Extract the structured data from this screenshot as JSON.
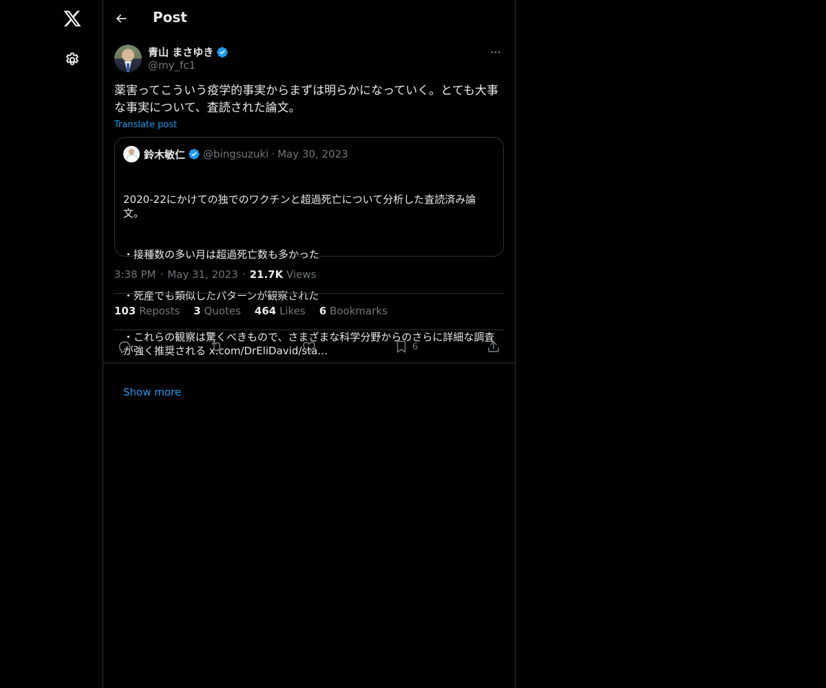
{
  "header": {
    "title": "Post"
  },
  "post": {
    "author": {
      "name": "青山 まさゆき",
      "handle": "@my_fc1"
    },
    "text": "薬害ってこういう疫学的事実からまずは明らかになっていく。とても大事な事実について、査読された論文。",
    "translate_label": "Translate post",
    "quote": {
      "author": {
        "name": "鈴木敏仁",
        "handle": "@bingsuzuki"
      },
      "separator": "·",
      "date": "May 30, 2023",
      "lines": [
        "2020-22にかけての独でのワクチンと超過死亡について分析した査読済み論文。",
        "・接種数の多い月は超過死亡数も多かった",
        "・死産でも類似したパターンが観察された",
        "・これらの観察は驚くべきもので、さまざまな科学分野からのさらに詳細な調査が強く推奨される x.com/DrEliDavid/sta…"
      ],
      "show_more": "Show more"
    },
    "meta": {
      "time": "3:38 PM",
      "dot": "·",
      "date": "May 31, 2023",
      "views_count": "21.7K",
      "views_label": "Views"
    },
    "stats": {
      "reposts_count": "103",
      "reposts_label": "Reposts",
      "quotes_count": "3",
      "quotes_label": "Quotes",
      "likes_count": "464",
      "likes_label": "Likes",
      "bookmarks_count": "6",
      "bookmarks_label": "Bookmarks"
    },
    "actions": {
      "bookmark_count": "6"
    }
  },
  "icons": {
    "nav": [
      "x-logo-icon",
      "settings-icon"
    ],
    "header": [
      "back-arrow-icon"
    ],
    "actions": [
      "reply-icon",
      "repost-icon",
      "like-icon",
      "bookmark-icon",
      "share-icon"
    ],
    "verified": "verified-badge-icon",
    "more": "more-icon"
  },
  "colors": {
    "background": "#000000",
    "text": "#e7e9ea",
    "secondary": "#71767b",
    "accent": "#1d9bf0",
    "border": "#2f3336"
  }
}
